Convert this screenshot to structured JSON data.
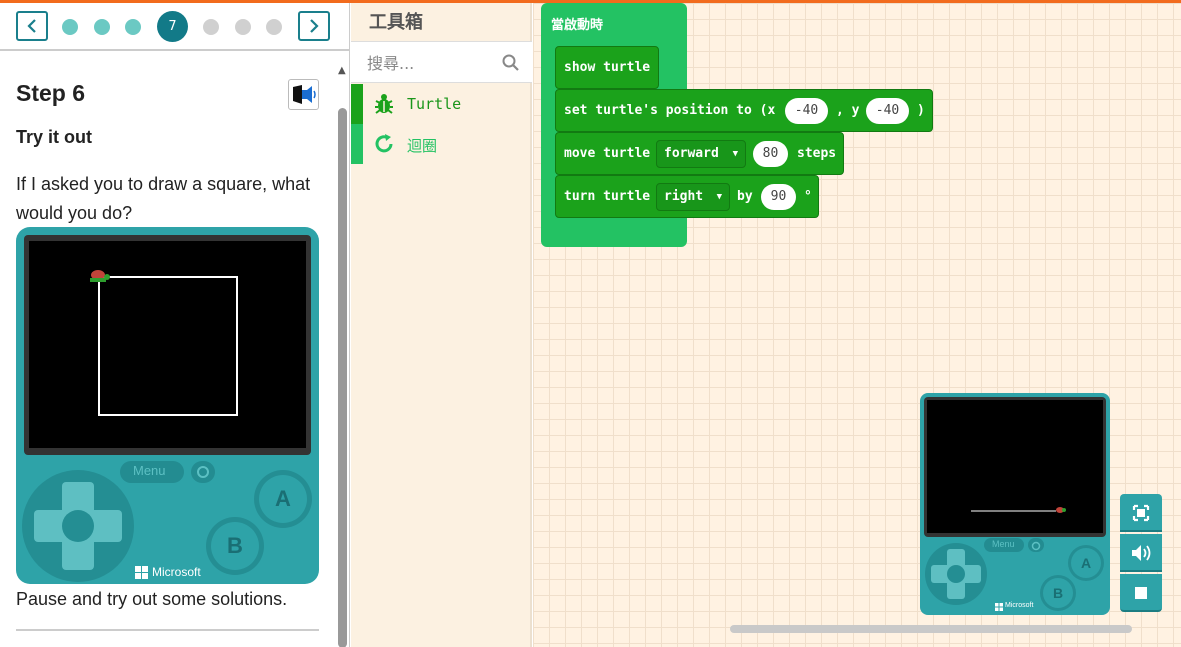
{
  "tutorial": {
    "step_current": "7",
    "step_title": "Step 6",
    "step_subtitle": "Try it out",
    "step_body": "If I asked you to draw a square, what would you do?",
    "step_footer": "Pause and try out some solutions.",
    "console": {
      "menu_label": "Menu",
      "button_a": "A",
      "button_b": "B",
      "brand": "Microsoft"
    }
  },
  "toolbox": {
    "title": "工具箱",
    "search_placeholder": "搜尋...",
    "categories": [
      {
        "label": "Turtle",
        "color": "#1ba21b"
      },
      {
        "label": "迴圈",
        "color": "#23c263"
      }
    ]
  },
  "workspace": {
    "on_start_label": "當啟動時",
    "blocks": {
      "show": "show turtle",
      "set_position_prefix": "set turtle's position to (x",
      "x_value": "-40",
      "y_label": ", y",
      "y_value": "-40",
      "close_paren": ")",
      "move_prefix": "move turtle",
      "move_direction": "forward",
      "move_value": "80",
      "move_suffix": "steps",
      "turn_prefix": "turn turtle",
      "turn_direction": "right",
      "turn_by": "by",
      "turn_value": "90",
      "turn_unit": "°"
    }
  },
  "simulator": {
    "menu_label": "Menu",
    "button_a": "A",
    "button_b": "B",
    "brand": "Microsoft"
  },
  "icons": {
    "prev": "chevron-left-icon",
    "next": "chevron-right-icon",
    "audio": "speaker-icon",
    "search": "search-icon",
    "turtle": "turtle-bug-icon",
    "loops": "loop-icon",
    "fullscreen": "fullscreen-icon",
    "sound": "volume-icon",
    "stop": "stop-icon"
  },
  "colors": {
    "accent": "#127a88",
    "turtle_category": "#1ba21b",
    "loops_category": "#23c263",
    "console": "#2ea3a8"
  }
}
